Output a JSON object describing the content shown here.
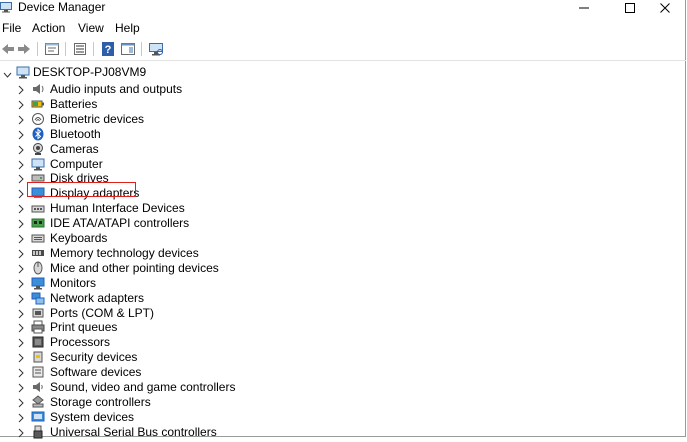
{
  "window": {
    "title": "Device Manager",
    "controls": [
      "minimize",
      "maximize",
      "close"
    ]
  },
  "menu": {
    "items": [
      "File",
      "Action",
      "View",
      "Help"
    ]
  },
  "toolbar": {
    "buttons": [
      "back-icon",
      "forward-icon",
      "properties-icon",
      "show-hide-console-tree-icon",
      "help-icon",
      "action-pane-icon",
      "scan-hardware-icon"
    ]
  },
  "tree": {
    "root": "DESKTOP-PJ08VM9",
    "items": [
      {
        "label": "Audio inputs and outputs",
        "icon": "speaker-icon"
      },
      {
        "label": "Batteries",
        "icon": "battery-icon"
      },
      {
        "label": "Biometric devices",
        "icon": "fingerprint-icon"
      },
      {
        "label": "Bluetooth",
        "icon": "bluetooth-icon"
      },
      {
        "label": "Cameras",
        "icon": "camera-icon"
      },
      {
        "label": "Computer",
        "icon": "computer-icon"
      },
      {
        "label": "Disk drives",
        "icon": "disk-drive-icon"
      },
      {
        "label": "Display adapters",
        "icon": "display-adapter-icon"
      },
      {
        "label": "Human Interface Devices",
        "icon": "hid-icon"
      },
      {
        "label": "IDE ATA/ATAPI controllers",
        "icon": "ide-controller-icon"
      },
      {
        "label": "Keyboards",
        "icon": "keyboard-icon"
      },
      {
        "label": "Memory technology devices",
        "icon": "memory-icon"
      },
      {
        "label": "Mice and other pointing devices",
        "icon": "mouse-icon"
      },
      {
        "label": "Monitors",
        "icon": "monitor-icon"
      },
      {
        "label": "Network adapters",
        "icon": "network-adapter-icon"
      },
      {
        "label": "Ports (COM & LPT)",
        "icon": "port-icon"
      },
      {
        "label": "Print queues",
        "icon": "printer-icon"
      },
      {
        "label": "Processors",
        "icon": "processor-icon"
      },
      {
        "label": "Security devices",
        "icon": "security-icon"
      },
      {
        "label": "Software devices",
        "icon": "software-device-icon"
      },
      {
        "label": "Sound, video and game controllers",
        "icon": "sound-icon"
      },
      {
        "label": "Storage controllers",
        "icon": "storage-icon"
      },
      {
        "label": "System devices",
        "icon": "system-device-icon"
      },
      {
        "label": "Universal Serial Bus controllers",
        "icon": "usb-icon"
      }
    ],
    "highlighted": "Display adapters",
    "highlight_color": "#e0201e"
  }
}
